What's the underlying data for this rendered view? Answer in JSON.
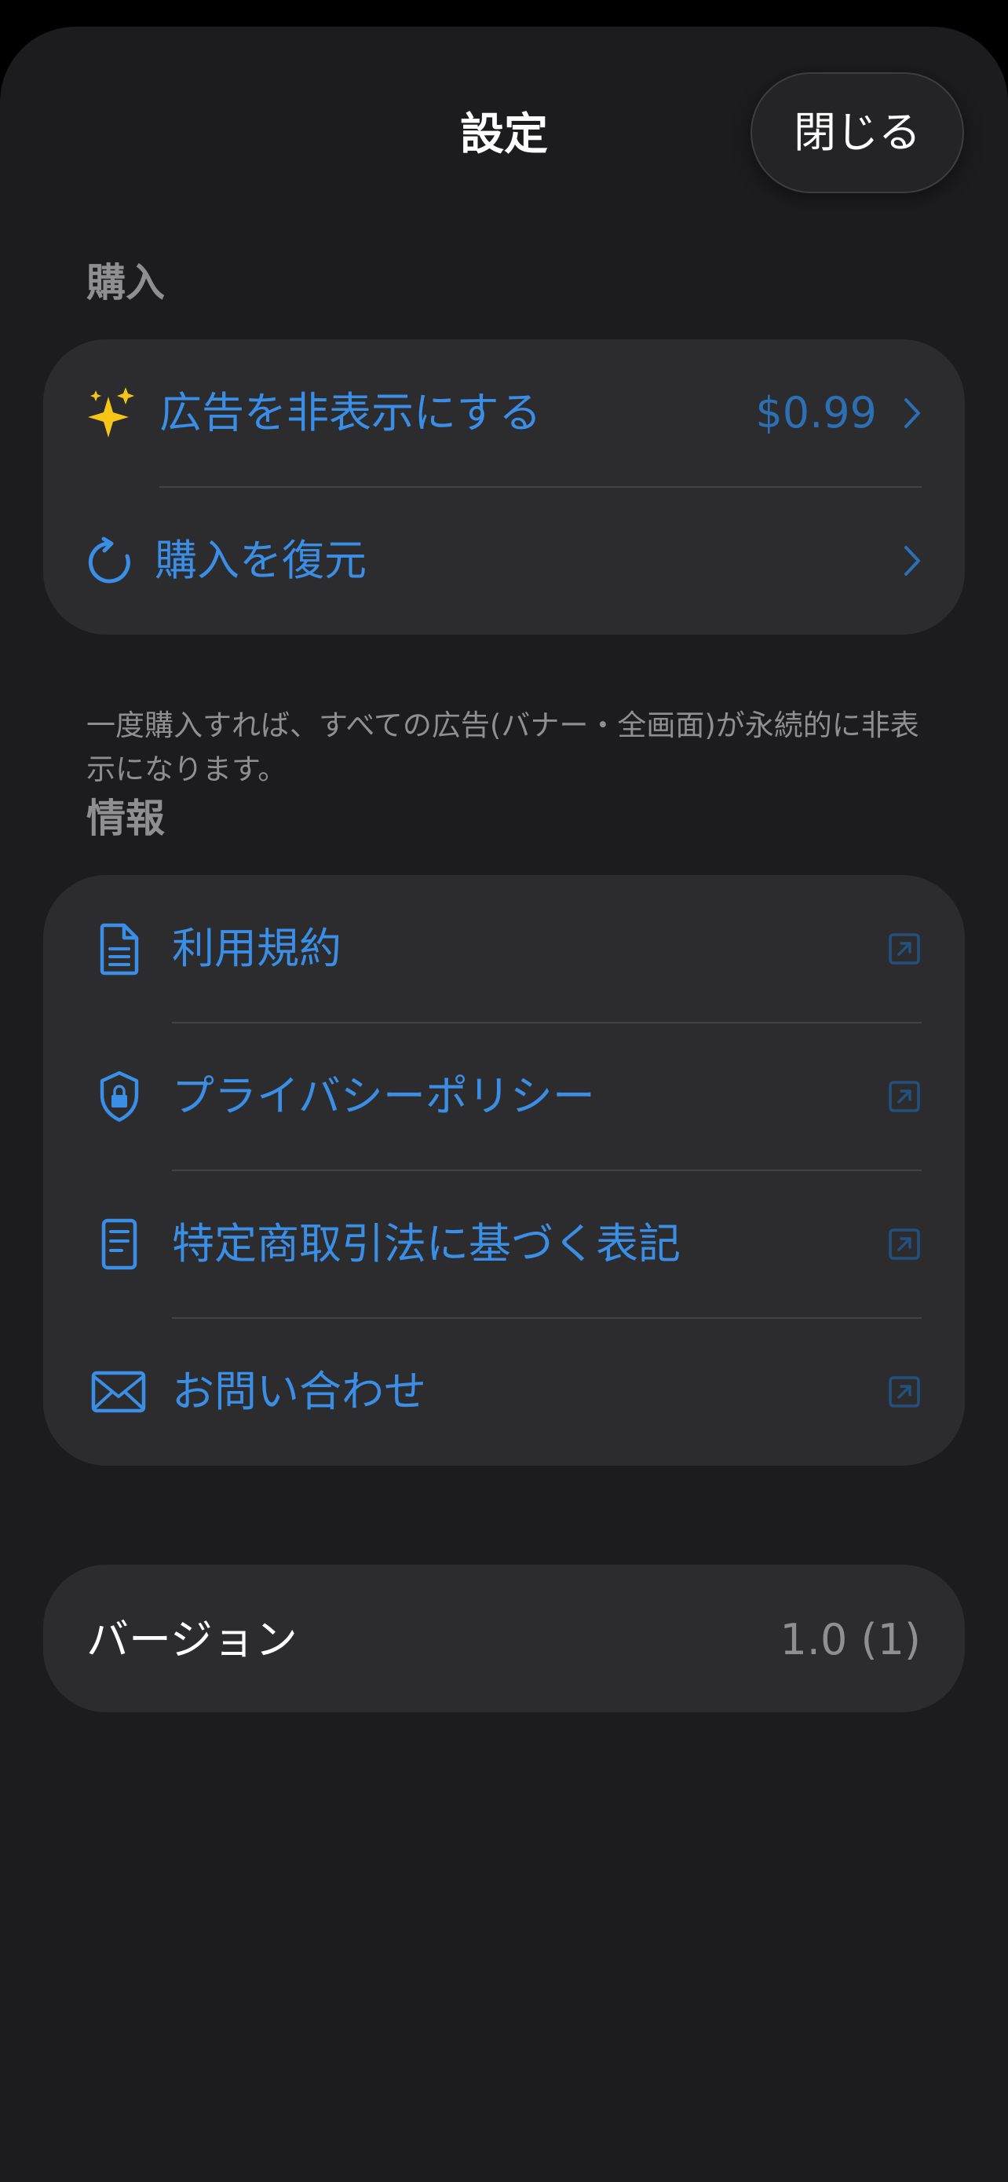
{
  "header": {
    "title": "設定",
    "close_label": "閉じる"
  },
  "purchase": {
    "section_title": "購入",
    "items": [
      {
        "label": "広告を非表示にする",
        "price": "$0.99",
        "icon": "sparkles-icon",
        "accessory": "chevron-right-icon"
      },
      {
        "label": "購入を復元",
        "icon": "restore-arrow-icon",
        "accessory": "chevron-right-icon"
      }
    ],
    "footnote": "一度購入すれば、すべての広告(バナー・全画面)が永続的に非表示になります。"
  },
  "info": {
    "section_title": "情報",
    "items": [
      {
        "label": "利用規約",
        "icon": "document-icon",
        "accessory": "external-link-icon"
      },
      {
        "label": "プライバシーポリシー",
        "icon": "shield-lock-icon",
        "accessory": "external-link-icon"
      },
      {
        "label": "特定商取引法に基づく表記",
        "icon": "list-document-icon",
        "accessory": "external-link-icon"
      },
      {
        "label": "お問い合わせ",
        "icon": "envelope-icon",
        "accessory": "external-link-icon"
      }
    ]
  },
  "version": {
    "label": "バージョン",
    "value": "1.0 (1)"
  },
  "colors": {
    "background": "#1c1c1e",
    "card": "#2c2c2e",
    "accent": "#3a8ee6",
    "secondary_text": "#8e8e93",
    "sparkle": "#f5c518"
  }
}
